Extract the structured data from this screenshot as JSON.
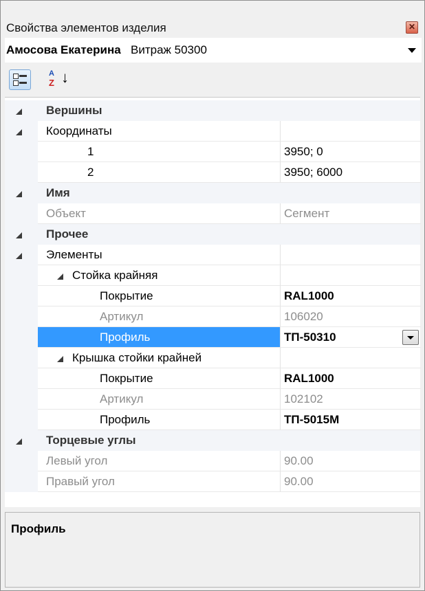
{
  "window": {
    "title": "Свойства элементов изделия",
    "close_glyph": "✕"
  },
  "selector": {
    "object_name": "Амосова Екатерина",
    "object_item": "Витраж 50300"
  },
  "toolbar": {
    "sort_icon_a": "A",
    "sort_icon_z": "Z",
    "sort_icon_arrow": "↓"
  },
  "grid": {
    "cat_vertices": "Вершины",
    "coordinates": "Координаты",
    "coord_1_name": "1",
    "coord_1_value": "3950; 0",
    "coord_2_name": "2",
    "coord_2_value": "3950; 6000",
    "cat_name": "Имя",
    "object_label": "Объект",
    "object_value": "Сегмент",
    "cat_other": "Прочее",
    "elements": "Элементы",
    "post_end": "Стойка крайняя",
    "post_coating_name": "Покрытие",
    "post_coating_value": "RAL1000",
    "post_article_name": "Артикул",
    "post_article_value": "106020",
    "post_profile_name": "Профиль",
    "post_profile_value": "ТП-50310",
    "cover_end": "Крышка стойки крайней",
    "cover_coating_name": "Покрытие",
    "cover_coating_value": "RAL1000",
    "cover_article_name": "Артикул",
    "cover_article_value": "102102",
    "cover_profile_name": "Профиль",
    "cover_profile_value": "ТП-5015М",
    "cat_end_angles": "Торцевые углы",
    "left_angle_name": "Левый угол",
    "left_angle_value": "90.00",
    "right_angle_name": "Правый угол",
    "right_angle_value": "90.00"
  },
  "description": {
    "title": "Профиль"
  },
  "icons": {
    "expand": "collapse-triangle-icon",
    "close": "close-icon",
    "categorized": "categorized-view-icon",
    "alphabetical": "sort-alphabetical-icon",
    "dropdown": "chevron-down-icon"
  },
  "colors": {
    "selection": "#3399ff",
    "category_bg": "#f3f5f9",
    "readonly_text": "#8d8d8d"
  }
}
